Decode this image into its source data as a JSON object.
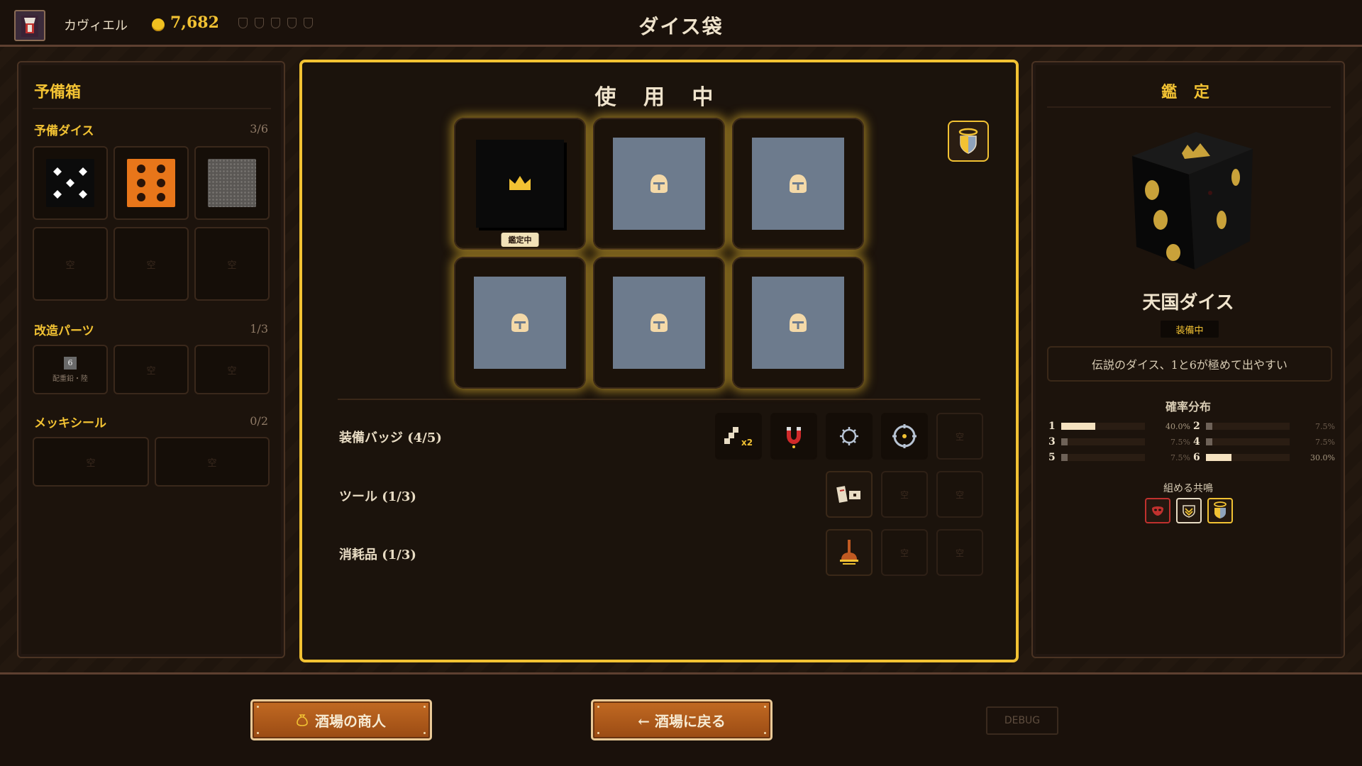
{
  "header": {
    "player_name": "カヴィエル",
    "gold": "7,682",
    "title": "ダイス袋",
    "pip_count": 5
  },
  "reserve": {
    "title": "予備箱",
    "dice_label": "予備ダイス",
    "dice_count": "3/6",
    "empty_label": "空",
    "mods_label": "改造パーツ",
    "mods_count": "1/3",
    "mod_part_value": "6",
    "mod_part_caption": "配重鉛・陸",
    "seal_label": "メッキシール",
    "seal_count": "0/2"
  },
  "active": {
    "title": "使 用 中",
    "appraising_tag": "鑑定中",
    "badges_label": "装備バッジ (4/5)",
    "tools_label": "ツール (1/3)",
    "consumables_label": "消耗品 (1/3)",
    "empty_label": "空",
    "badge_multiplier": "x2"
  },
  "appraisal": {
    "title": "鑑 定",
    "die_name": "天国ダイス",
    "status": "装備中",
    "description": "伝説のダイス、1と6が極めて出やすい",
    "prob_title": "確率分布",
    "probabilities": [
      {
        "face": "1",
        "pct": "40.0%",
        "value": 0.4
      },
      {
        "face": "2",
        "pct": "7.5%",
        "value": 0.075
      },
      {
        "face": "3",
        "pct": "7.5%",
        "value": 0.075
      },
      {
        "face": "4",
        "pct": "7.5%",
        "value": 0.075
      },
      {
        "face": "5",
        "pct": "7.5%",
        "value": 0.075
      },
      {
        "face": "6",
        "pct": "30.0%",
        "value": 0.3
      }
    ],
    "resonance_title": "組める共鳴"
  },
  "footer": {
    "merchant_button": "酒場の商人",
    "back_button": "← 酒場に戻る",
    "debug_button": "DEBUG"
  },
  "colors": {
    "accent_gold": "#f2c233",
    "button_orange": "#b35b1b",
    "steel_face": "#6d7b8d"
  }
}
